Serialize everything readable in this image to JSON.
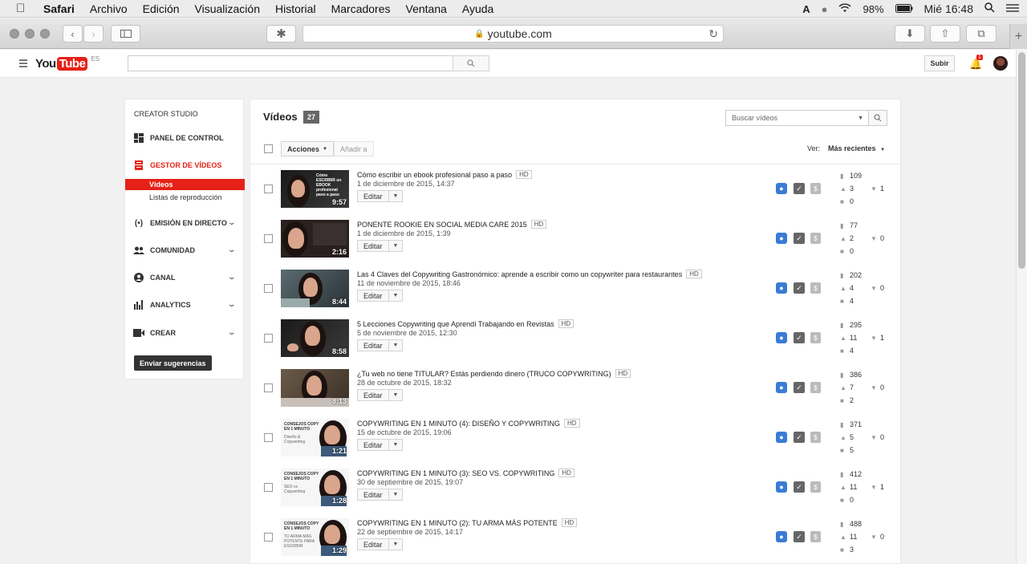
{
  "menubar": {
    "app": "Safari",
    "items": [
      "Archivo",
      "Edición",
      "Visualización",
      "Historial",
      "Marcadores",
      "Ventana",
      "Ayuda"
    ],
    "battery": "98%",
    "clock": "Mié 16:48"
  },
  "browser": {
    "url": "youtube.com"
  },
  "youtube": {
    "logo_you": "You",
    "logo_tube": "Tube",
    "lang": "ES",
    "upload_label": "Subir",
    "notifications": "1"
  },
  "sidebar": {
    "title": "CREATOR STUDIO",
    "items": [
      {
        "label": "PANEL DE CONTROL",
        "icon": "dashboard-icon"
      },
      {
        "label": "GESTOR DE VÍDEOS",
        "icon": "video-manager-icon"
      },
      {
        "label": "EMISIÓN EN DIRECTO",
        "icon": "live-broadcast-icon"
      },
      {
        "label": "COMUNIDAD",
        "icon": "community-icon"
      },
      {
        "label": "CANAL",
        "icon": "channel-icon"
      },
      {
        "label": "ANALYTICS",
        "icon": "analytics-icon"
      },
      {
        "label": "CREAR",
        "icon": "create-icon"
      }
    ],
    "subitems": [
      "Vídeos",
      "Listas de reproducción"
    ],
    "feedback_label": "Enviar sugerencias"
  },
  "main": {
    "title": "Vídeos",
    "count": "27",
    "search_placeholder": "Buscar vídeos",
    "actions_label": "Acciones",
    "add_to_label": "Añadir a",
    "view_label": "Ver:",
    "view_value": "Más recientes",
    "edit_label": "Editar",
    "hd_label": "HD"
  },
  "videos": [
    {
      "title": "Cómo escribir un ebook profesional paso a paso",
      "date": "1 de diciembre de 2015, 14:37",
      "duration": "9:57",
      "views": "109",
      "likes": "3",
      "dislikes": "1",
      "comments": "0"
    },
    {
      "title": "PONENTE ROOKIE EN SOCIAL MEDIA CARE 2015",
      "date": "1 de diciembre de 2015, 1:39",
      "duration": "2:16",
      "views": "77",
      "likes": "2",
      "dislikes": "0",
      "comments": "0"
    },
    {
      "title": "Las 4 Claves del Copywriting Gastronómico: aprende a escribir como un copywriter para restaurantes",
      "date": "11 de noviembre de 2015, 18:46",
      "duration": "8:44",
      "views": "202",
      "likes": "4",
      "dislikes": "0",
      "comments": "4"
    },
    {
      "title": "5 Lecciones Copywriting que Aprendí Trabajando en Revistas",
      "date": "5 de noviembre de 2015, 12:30",
      "duration": "8:58",
      "views": "295",
      "likes": "11",
      "dislikes": "1",
      "comments": "4"
    },
    {
      "title": "¿Tu web no tiene TITULAR? Estás perdiendo dinero (TRUCO COPYWRITING)",
      "date": "28 de octubre de 2015, 18:32",
      "duration": "8:13",
      "views": "386",
      "likes": "7",
      "dislikes": "0",
      "comments": "2"
    },
    {
      "title": "COPYWRITING EN 1 MINUTO (4): DISEÑO Y COPYWRITING",
      "date": "15 de octubre de 2015, 19:06",
      "duration": "1:21",
      "views": "371",
      "likes": "5",
      "dislikes": "0",
      "comments": "5"
    },
    {
      "title": "COPYWRITING EN 1 MINUTO (3): SEO VS. COPYWRITING",
      "date": "30 de septiembre de 2015, 19:07",
      "duration": "1:28",
      "views": "412",
      "likes": "11",
      "dislikes": "1",
      "comments": "0"
    },
    {
      "title": "COPYWRITING EN 1 MINUTO (2): TU ARMA MÁS POTENTE",
      "date": "22 de septiembre de 2015, 14:17",
      "duration": "1:29",
      "views": "488",
      "likes": "11",
      "dislikes": "0",
      "comments": "3"
    }
  ],
  "thumb_texts": {
    "t1": "Cómo ESCRIBIR un EBOOK profesional paso a paso",
    "copy_series": "CONSEJOS COPY EN 1 MINUTO",
    "t6": "Diseño & Copywriting",
    "t7": "SEO vs Copywriting",
    "t8": "TU ARMA MÁS POTENTE PARA ESCRIBIR"
  }
}
